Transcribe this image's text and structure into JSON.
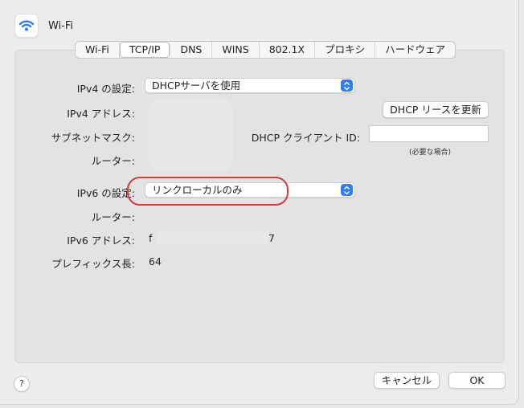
{
  "window": {
    "title": "Wi-Fi"
  },
  "tabs": [
    "Wi-Fi",
    "TCP/IP",
    "DNS",
    "WINS",
    "802.1X",
    "プロキシ",
    "ハードウェア"
  ],
  "active_tab": "TCP/IP",
  "ipv4": {
    "config_label": "IPv4 の設定:",
    "config_value": "DHCPサーバを使用",
    "address_label": "IPv4 アドレス:",
    "subnet_label": "サブネットマスク:",
    "router_label": "ルーター:"
  },
  "dhcp": {
    "renew_label": "DHCP リースを更新",
    "client_id_label": "DHCP クライアント ID:",
    "client_id_value": "",
    "required_note": "(必要な場合)"
  },
  "ipv6": {
    "config_label": "IPv6 の設定:",
    "config_value": "リンクローカルのみ",
    "router_label": "ルーター:",
    "address_label": "IPv6 アドレス:",
    "address_visible_start": "f",
    "address_visible_end": "7",
    "prefix_label": "プレフィックス長:",
    "prefix_value": "64"
  },
  "footer": {
    "help_label": "?",
    "cancel_label": "キャンセル",
    "ok_label": "OK"
  },
  "colors": {
    "accent": "#2f7ef2",
    "annotation": "#d93a3a"
  }
}
